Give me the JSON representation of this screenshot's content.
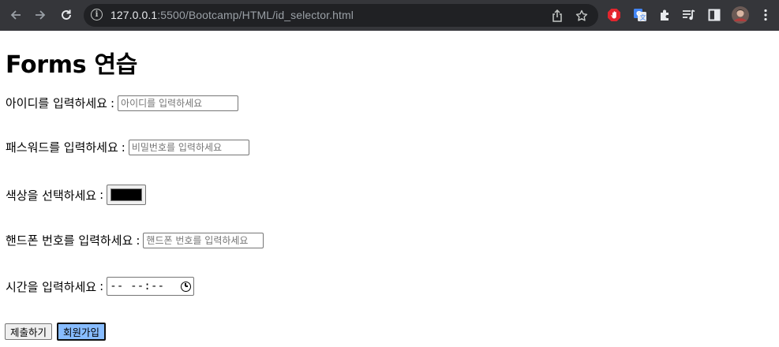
{
  "browser": {
    "url_host": "127.0.0.1",
    "url_path": ":5500/Bootcamp/HTML/id_selector.html",
    "back_icon": "arrow-left",
    "forward_icon": "arrow-right",
    "reload_icon": "reload",
    "info_icon": "i"
  },
  "page": {
    "title": "Forms 연습",
    "id_label": "아이디를 입력하세요",
    "id_placeholder": "아이디를 입력하세요",
    "password_label": "패스워드를 입력하세요",
    "password_placeholder": "비밀번호를 입력하세요",
    "color_label": "색상을 선택하세요",
    "color_value": "#000000",
    "phone_label": "핸드폰 번호를 입력하세요",
    "phone_placeholder": "핸드폰 번호를 입력하세요",
    "time_label": "시간을 입력하세요",
    "time_value": "-- --:--",
    "colon": ":",
    "submit_label": "제출하기",
    "signup_label": "회원가입",
    "signup_color": "#87bcff"
  }
}
